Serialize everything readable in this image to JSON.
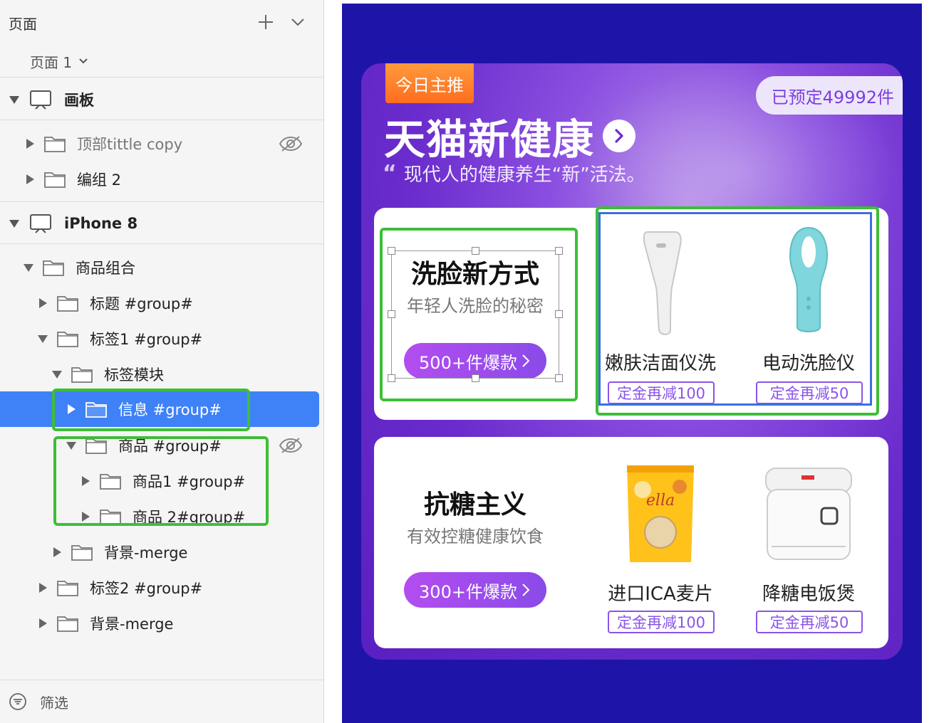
{
  "panel": {
    "pages_title": "页面",
    "current_page": "页面 1",
    "layers": {
      "board": "画板",
      "top_title_copy": "顶部tittle copy",
      "group2": "编组 2",
      "iphone8": "iPhone 8",
      "goods_combo": "商品组合",
      "title_group": "标题 #group#",
      "tag1_group": "标签1 #group#",
      "tag_module": "标签模块",
      "info_group": "信息 #group#",
      "goods_group": "商品 #group#",
      "goods1_group": "商品1 #group#",
      "goods2_group": "商品 2#group#",
      "bg_merge_inner": "背景-merge",
      "tag2_group": "标签2 #group#",
      "bg_merge_outer": "背景-merge"
    },
    "filter_label": "筛选"
  },
  "colors": {
    "selection_blue": "#3f82f7",
    "highlight_green": "#3dbe37",
    "artboard_bg": "#1e14a8",
    "accent_purple": "#8a55e8",
    "tag_orange": "#ff7a2a"
  },
  "banner": {
    "tag": "今日主推",
    "reserved": "已预定49992件",
    "title": "天猫新健康",
    "subtitle": "现代人的健康养生“新”活法。"
  },
  "card1": {
    "title": "洗脸新方式",
    "desc": "年轻人洗脸的秘密",
    "button": "500+件爆款",
    "products": [
      {
        "name": "嫩肤洁面仪洗",
        "coupon": "定金再减100"
      },
      {
        "name": "电动洗脸仪",
        "coupon": "定金再减50"
      }
    ]
  },
  "card2": {
    "title": "抗糖主义",
    "desc": "有效控糖健康饮食",
    "button": "300+件爆款",
    "products": [
      {
        "name": "进口ICA麦片",
        "coupon": "定金再减100"
      },
      {
        "name": "降糖电饭煲",
        "coupon": "定金再减50"
      }
    ]
  }
}
